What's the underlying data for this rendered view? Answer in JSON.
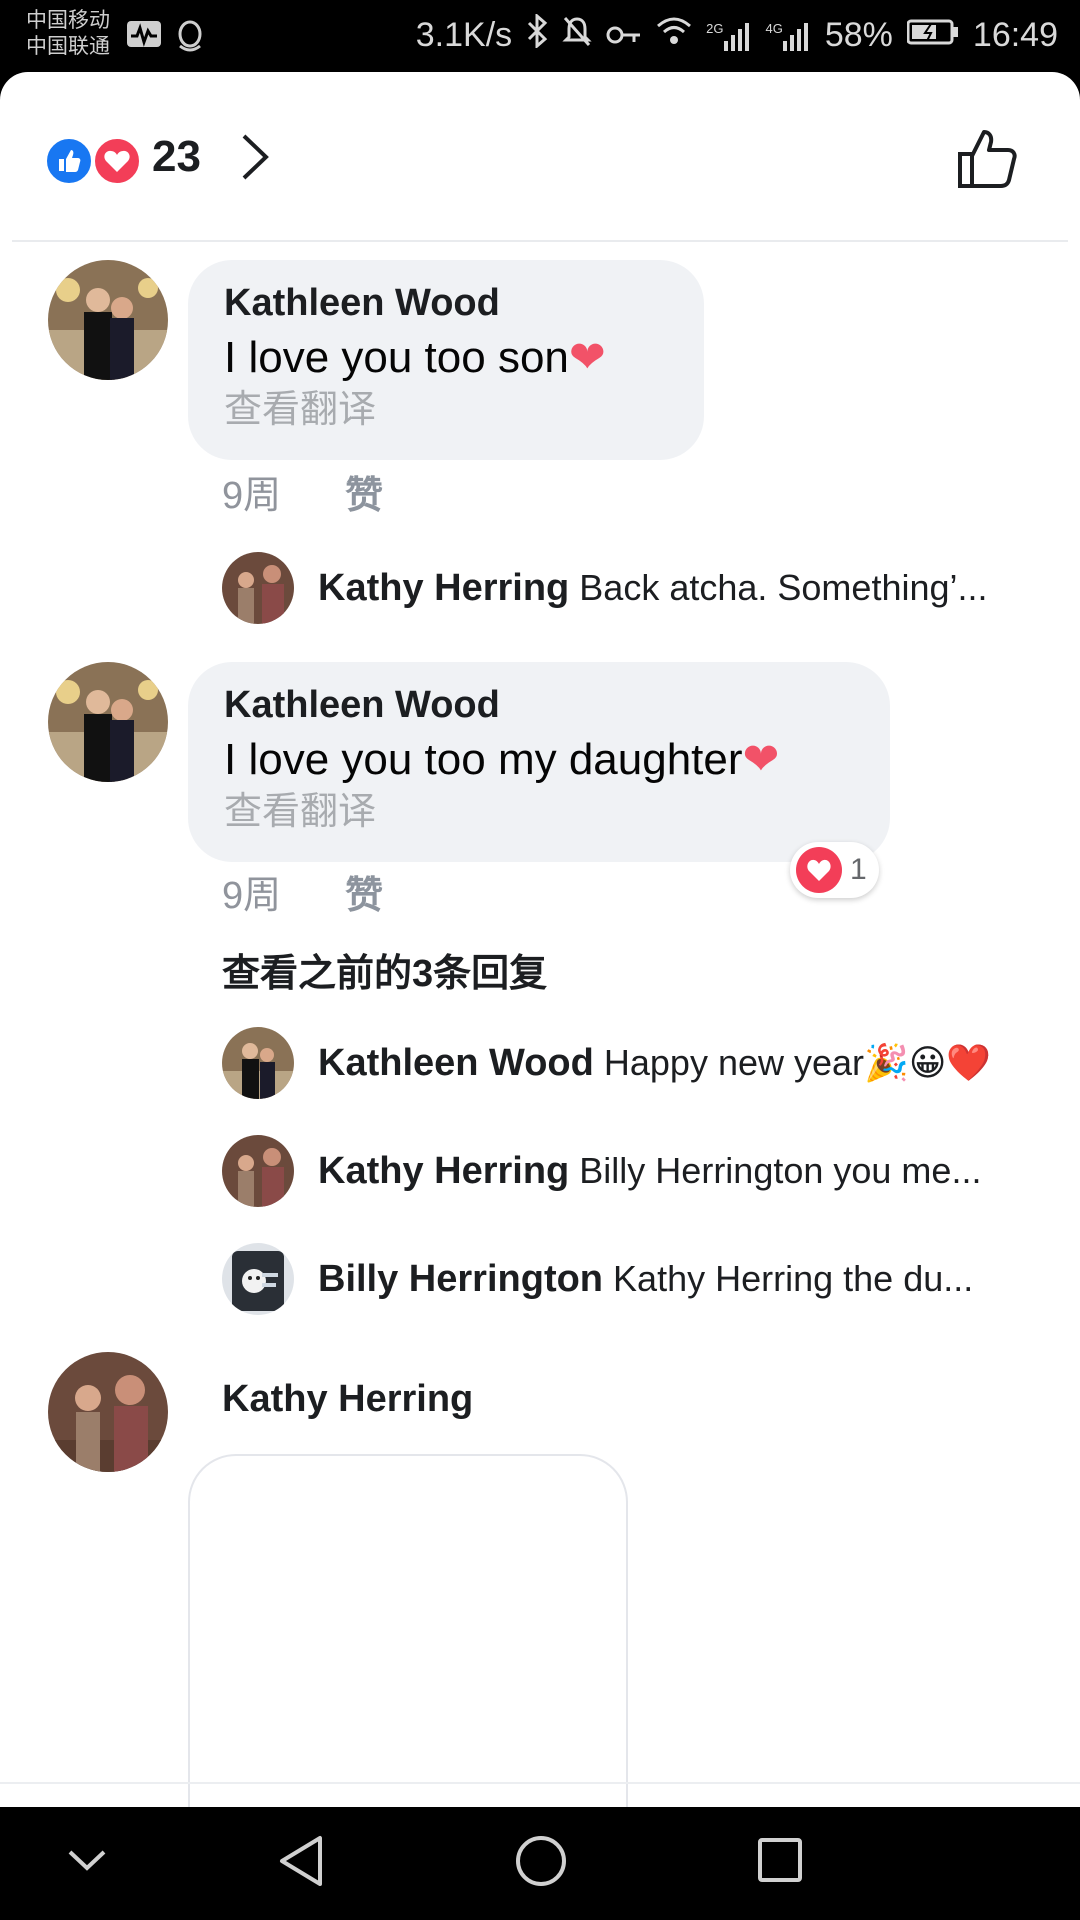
{
  "status_bar": {
    "carrier1": "中国移动",
    "carrier2": "中国联通",
    "speed": "3.1K/s",
    "net2g": "2G",
    "net4g": "4G",
    "battery": "58%",
    "time": "16:49"
  },
  "reactions": {
    "count": "23"
  },
  "comments": [
    {
      "author": "Kathleen Wood",
      "text": "I love you too son",
      "translate": "查看翻译",
      "age": "9周",
      "like": "赞"
    },
    {
      "author": "Kathleen Wood",
      "text": "I love you too my daughter",
      "translate": "查看翻译",
      "age": "9周",
      "like": "赞",
      "reaction_count": "1"
    }
  ],
  "reply_preview": {
    "name": "Kathy Herring",
    "text": "Back atcha. Something’..."
  },
  "view_previous": "查看之前的3条回复",
  "replies": [
    {
      "name": "Kathleen Wood",
      "text": "Happy new year🎉😀❤️"
    },
    {
      "name": "Kathy Herring",
      "text": "Billy Herrington you me..."
    },
    {
      "name": "Billy Herrington",
      "text": "Kathy Herring the du..."
    }
  ],
  "last_comment": {
    "author": "Kathy Herring"
  },
  "colors": {
    "like_blue": "#1877f2",
    "love_red": "#f33e58",
    "bubble_bg": "#f0f2f5"
  }
}
